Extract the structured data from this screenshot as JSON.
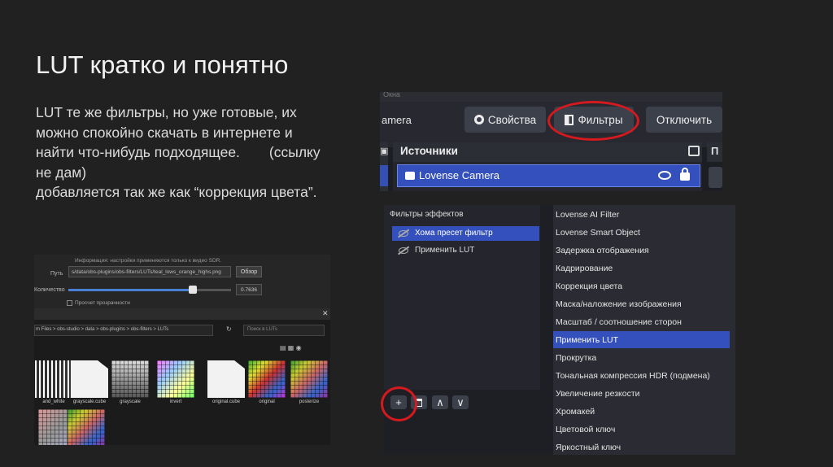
{
  "slide": {
    "title": "LUT кратко и понятно",
    "body_part1": "LUT те же фильтры, но уже готовые, их можно спокойно скачать в интернете и найти что-нибудь подходящее.",
    "body_part2": "(ссылку не дам)",
    "body_part3": "добавляется так же как “коррекция цвета”."
  },
  "obs_toolbar": {
    "strip_text": "Окна",
    "camera_label": "amera",
    "properties_label": "Свойства",
    "filters_label": "Фильтры",
    "disable_label": "Отключить",
    "right_panel_letter": "П"
  },
  "sources": {
    "title": "Источники",
    "item_label": "Lovense Camera"
  },
  "filters_dialog": {
    "panel_title": "Фильтры эффектов",
    "filters": [
      {
        "label": "Хома пресет фильтр",
        "selected": true
      },
      {
        "label": "Применить LUT",
        "selected": false
      }
    ],
    "add_label": "+",
    "up_label": "∧",
    "down_label": "∨"
  },
  "filter_menu": {
    "highlight_color": "#3450bc",
    "items": [
      "Lovense AI Filter",
      "Lovense Smart Object",
      "Задержка отображения",
      "Кадрирование",
      "Коррекция цвета",
      "Маска/наложение изображения",
      "Масштаб / соотношение сторон",
      "Применить LUT",
      "Прокрутка",
      "Тональная компрессия HDR (подмена)",
      "Увеличение резкости",
      "Хромакей",
      "Цветовой ключ",
      "Яркостный ключ"
    ],
    "selected": "Применить LUT"
  },
  "lut_settings": {
    "info_text": "Информация: настройки применяются только к видео SDR.",
    "path_label": "Путь",
    "path_value": "s/data/obs-plugins/obs-filters/LUTs/teal_lows_orange_highs.png",
    "browse_label": "Обзор",
    "amount_label": "Количество",
    "amount_value": "0.7636",
    "transparency_label": "Просчет прозрачности"
  },
  "file_browser": {
    "address": "m Files  >  obs-studio  >  data  >  obs-plugins  >  obs-filters  >  LUTs",
    "search_placeholder": "Поиск в LUTs",
    "files": [
      {
        "name": "and_white",
        "kind": "bw"
      },
      {
        "name": "grayscale.cube",
        "kind": "doc"
      },
      {
        "name": "grayscale",
        "kind": "gray"
      },
      {
        "name": "invert",
        "kind": "invert"
      },
      {
        "name": "original.cube",
        "kind": "doc"
      },
      {
        "name": "original",
        "kind": "orig"
      },
      {
        "name": "posterize",
        "kind": "post"
      }
    ]
  }
}
